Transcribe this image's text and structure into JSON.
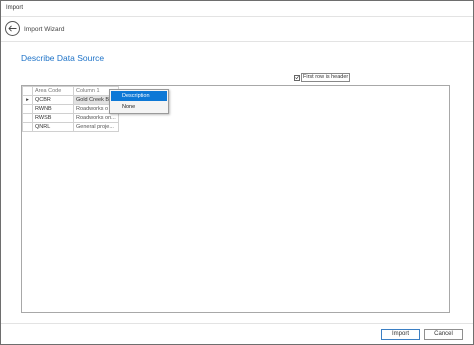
{
  "window": {
    "title": "Import"
  },
  "header": {
    "title": "Import Wizard",
    "back_icon": "arrow-left-icon"
  },
  "section": {
    "title": "Describe Data Source"
  },
  "options": {
    "first_row_is_header_label": "First row is header",
    "first_row_is_header_checked": true
  },
  "grid": {
    "columns": [
      "Area Code",
      "Column 1"
    ],
    "current_row_marker": "▸",
    "rows": [
      [
        "QCBR",
        "Gold Creek B"
      ],
      [
        "RWNB",
        "Roadworks o"
      ],
      [
        "RWSB",
        "Roadworks on..."
      ],
      [
        "QNRL",
        "General proje..."
      ]
    ]
  },
  "context_menu": {
    "items": [
      "Description",
      "None"
    ],
    "active_index": 0
  },
  "footer": {
    "import_label": "Import",
    "cancel_label": "Cancel"
  },
  "colors": {
    "accent": "#1e73c8",
    "menu_highlight": "#0d78d6"
  }
}
